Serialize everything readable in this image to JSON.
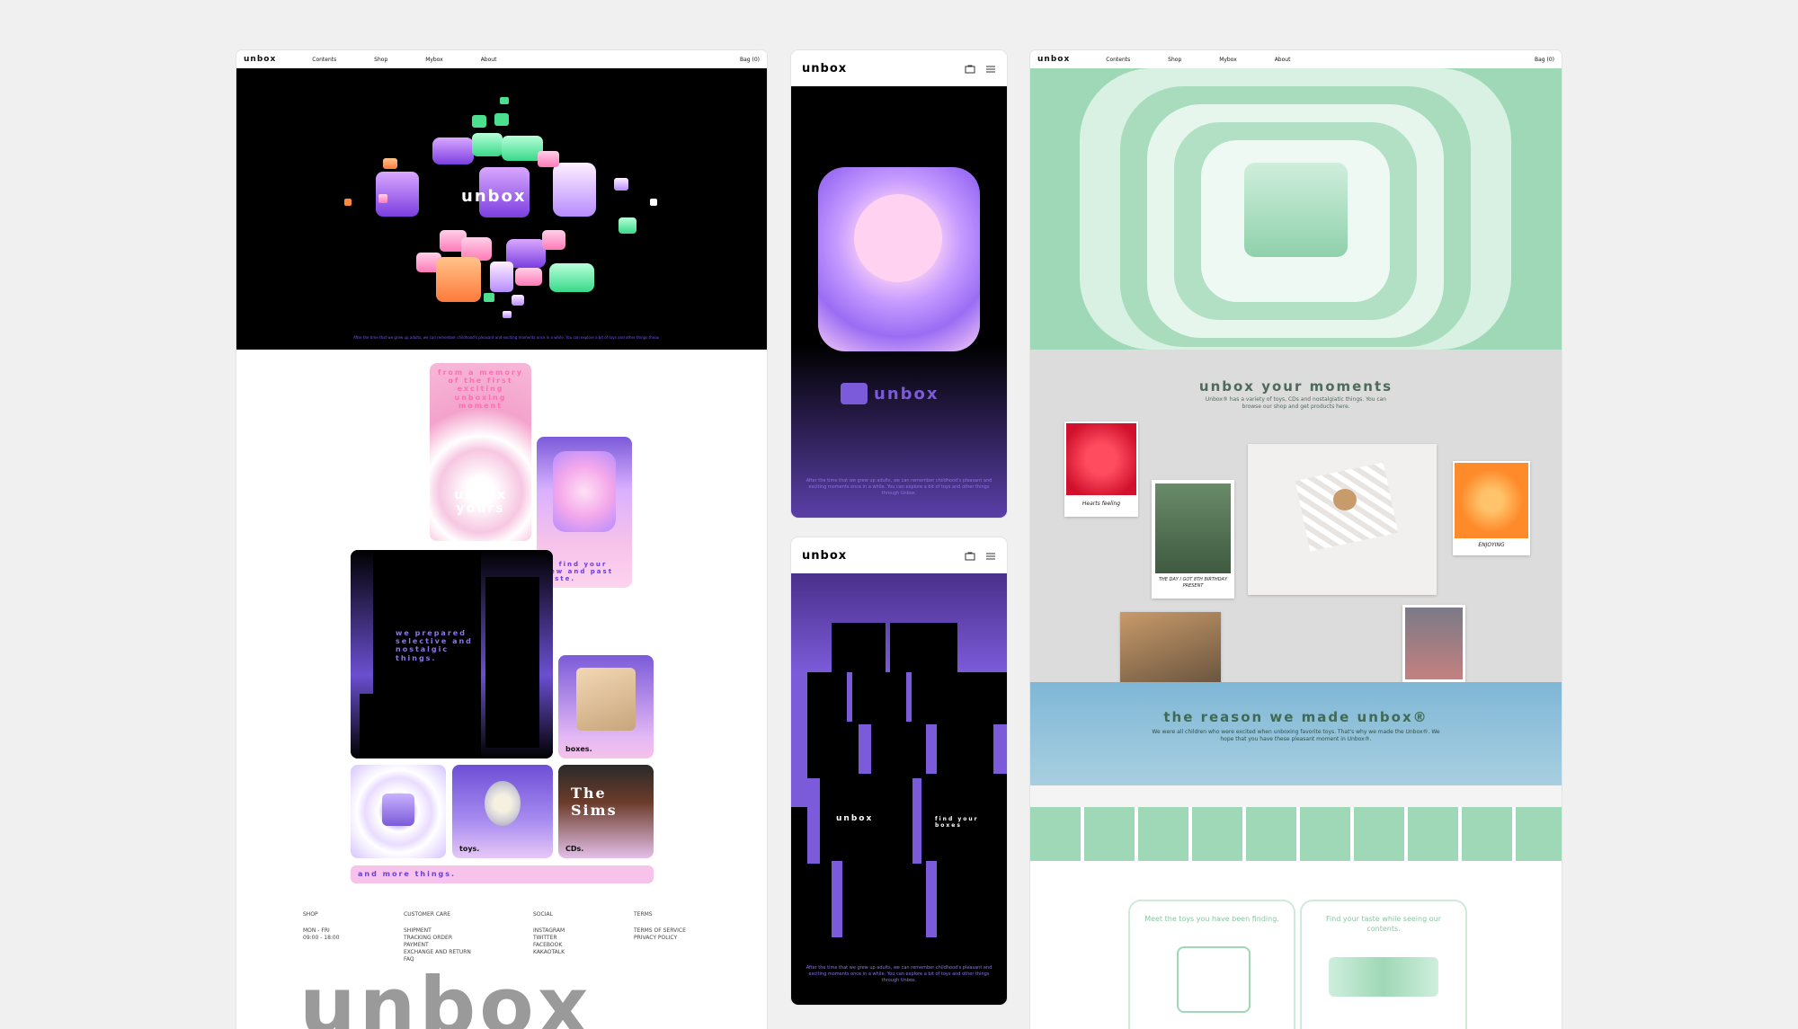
{
  "desktop_left": {
    "nav": {
      "logo": "unbox",
      "items": [
        "Contents",
        "Shop",
        "Mybox",
        "About"
      ],
      "right": "Bag (0)"
    },
    "hero": {
      "logo": "unbox",
      "caption": "After the time that we grew up adults, we can remember childhood's pleasant and exciting moments once in a while. You can explore a bit of toys and other things through Unbox."
    },
    "tiles": {
      "memory": "from a memory of the first exciting unboxing moment",
      "yours": "unbox yours",
      "taste": "to find your new and past taste.",
      "prepared": "we prepared selective and nostalgic things.",
      "boxes": "boxes.",
      "toys": "toys.",
      "cds": "CDs.",
      "sims": "The Sims",
      "more": "and more things."
    },
    "footer": {
      "shop": {
        "title": "SHOP",
        "lines": [
          "MON - FRI",
          "09:00 - 18:00"
        ]
      },
      "care": {
        "title": "CUSTOMER CARE",
        "lines": [
          "SHIPMENT",
          "TRACKING ORDER",
          "PAYMENT",
          "EXCHANGE AND RETURN",
          "FAQ"
        ]
      },
      "social": {
        "title": "SOCIAL",
        "lines": [
          "INSTAGRAM",
          "TWITTER",
          "FACEBOOK",
          "KAKAOTALK"
        ]
      },
      "terms": {
        "title": "TERMS",
        "lines": [
          "TERMS OF SERVICE",
          "PRIVACY POLICY"
        ]
      },
      "big_logo": "unbox"
    }
  },
  "mobile_top": {
    "logo": "unbox",
    "brand": "unbox",
    "caption": "After the time that we grew up adults, we can remember childhood's pleasant and exciting moments once in a while. You can explore a bit of toys and other things through Unbox."
  },
  "mobile_bottom": {
    "logo": "unbox",
    "brand": "unbox",
    "find": "find your boxes",
    "caption": "After the time that we grew up adults, we can remember childhood's pleasant and exciting moments once in a while. You can explore a bit of toys and other things through Unbox."
  },
  "desktop_right": {
    "nav": {
      "logo": "unbox",
      "items": [
        "Contents",
        "Shop",
        "Mybox",
        "About"
      ],
      "right": "Bag (0)"
    },
    "moments": {
      "title": "unbox your moments",
      "text": "Unbox® has a variety of toys, CDs and nostalgiatic things. You can browse our shop and get products here.",
      "cap1": "Hearts feeling",
      "cap2": "THE DAY I GOT 8TH BIRTHDAY PRESENT",
      "cap3": "ENJOYING"
    },
    "reason": {
      "title": "the reason we made unbox®",
      "text": "We were all children who were excited when unboxing favorite toys. That's why we made the Unbox®. We hope that you have these pleasant moment in Unbox®."
    },
    "cards": {
      "left": "Meet the toys you have been finding.",
      "right": "Find your taste while seeing our contents."
    }
  },
  "colors": {
    "purple": "#7a5ad6",
    "pink": "#f6b8d8",
    "mint": "#9fd8b6",
    "black": "#000000",
    "bg": "#f0f0f0"
  }
}
